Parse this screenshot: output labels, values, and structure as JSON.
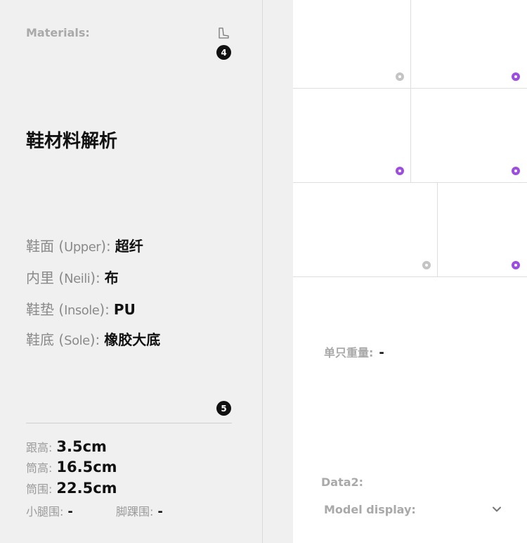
{
  "left": {
    "materials_label": "Materials:",
    "badge_top": "4",
    "badge_bottom": "5",
    "title": "鞋材料解析",
    "materials": [
      {
        "key_cn": "鞋面",
        "key_en": "Upper",
        "colon": ":",
        "value": "超纤"
      },
      {
        "key_cn": "内里",
        "key_en": "Neili",
        "colon": ":",
        "value": "布"
      },
      {
        "key_cn": "鞋垫",
        "key_en": "Insole",
        "colon": ":",
        "value": "PU"
      },
      {
        "key_cn": "鞋底",
        "key_en": "Sole",
        "colon": ":",
        "value": "橡胶大底"
      }
    ],
    "specs": [
      {
        "key": "跟高:",
        "value": "3.5cm"
      },
      {
        "key": "筒高:",
        "value": "16.5cm"
      },
      {
        "key": "筒围:",
        "value": "22.5cm"
      },
      {
        "key": "小腿围:",
        "value": "-"
      },
      {
        "key": "脚踝围:",
        "value": "-"
      }
    ]
  },
  "right": {
    "weight_label": "单只重量:",
    "weight_value": "-",
    "data2_label": "Data2:",
    "model_display_label": "Model display:"
  },
  "colors": {
    "panel_bg": "#f0f0f0",
    "accent_purple": "#9d4ee0",
    "dot_gray": "#c4c4c4",
    "label_gray": "#a9a9a9"
  },
  "icons": {
    "boot": "boot-outline-icon",
    "chevron": "chevron-down-icon"
  }
}
